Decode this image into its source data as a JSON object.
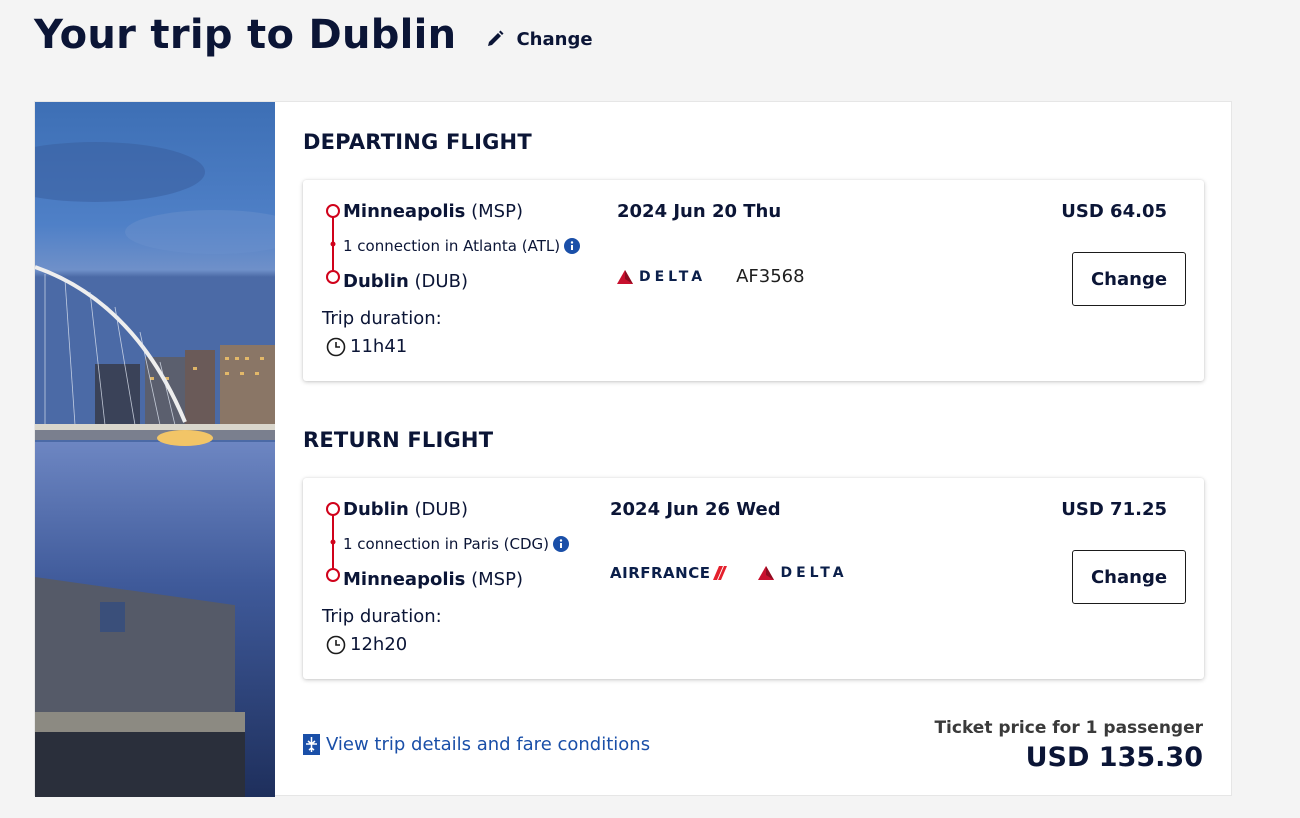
{
  "header": {
    "title": "Your trip to Dublin",
    "change_label": "Change"
  },
  "departing": {
    "section_title": "DEPARTING FLIGHT",
    "origin_city": "Minneapolis",
    "origin_code": "(MSP)",
    "connection": "1 connection in Atlanta (ATL)",
    "destination_city": "Dublin",
    "destination_code": "(DUB)",
    "duration_label": "Trip duration:",
    "duration": "11h41",
    "date": "2024 Jun 20 Thu",
    "airline": "DELTA",
    "flight_number": "AF3568",
    "price": "USD 64.05",
    "change_label": "Change"
  },
  "return": {
    "section_title": "RETURN FLIGHT",
    "origin_city": "Dublin",
    "origin_code": "(DUB)",
    "connection": "1 connection in Paris (CDG)",
    "destination_city": "Minneapolis",
    "destination_code": "(MSP)",
    "duration_label": "Trip duration:",
    "duration": "12h20",
    "date": "2024 Jun 26 Wed",
    "airlines": [
      "AIRFRANCE",
      "DELTA"
    ],
    "price": "USD 71.25",
    "change_label": "Change"
  },
  "footer": {
    "details_link": "View trip details and fare conditions",
    "ticket_label": "Ticket price for 1 passenger",
    "ticket_total": "USD 135.30"
  },
  "icons": {
    "edit": "pencil-icon",
    "info": "info-icon",
    "clock": "clock-icon",
    "details": "fare-details-icon"
  },
  "colors": {
    "title": "#0b1536",
    "route": "#d0021b",
    "link": "#1a4fa8",
    "delta_red": "#c8102e",
    "airfrance_red": "#e4202c",
    "background": "#f4f4f4"
  }
}
